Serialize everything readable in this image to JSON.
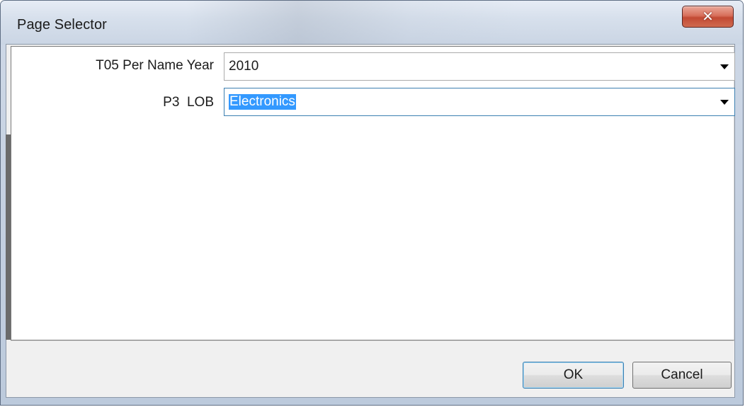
{
  "window": {
    "title": "Page Selector",
    "close_glyph": "✖"
  },
  "fields": [
    {
      "label": "T05 Per Name Year",
      "value": "2010",
      "selected": false
    },
    {
      "label": "P3  LOB",
      "value": "Electronics",
      "selected": true
    }
  ],
  "buttons": {
    "ok_label": "OK",
    "cancel_label": "Cancel"
  },
  "colors": {
    "selection_highlight": "#3399ff",
    "focus_border": "#3c7fb1",
    "close_button": "#c24a34"
  },
  "icons": {
    "close": "close-icon",
    "dropdown": "chevron-down-icon"
  }
}
